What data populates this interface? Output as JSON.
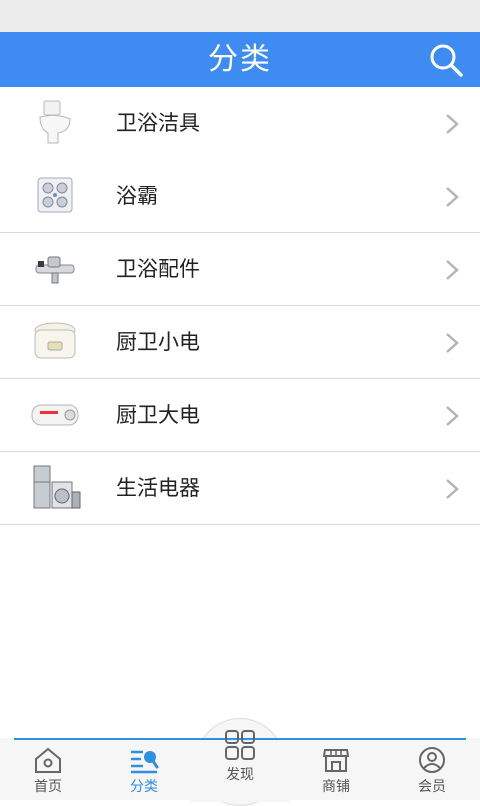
{
  "header": {
    "title": "分类"
  },
  "categories": [
    {
      "label": "卫浴洁具",
      "icon": "toilet-icon"
    },
    {
      "label": "浴霸",
      "icon": "bath-heater-icon"
    },
    {
      "label": "卫浴配件",
      "icon": "faucet-icon"
    },
    {
      "label": "厨卫小电",
      "icon": "rice-cooker-icon"
    },
    {
      "label": "厨卫大电",
      "icon": "water-heater-icon"
    },
    {
      "label": "生活电器",
      "icon": "appliances-icon"
    }
  ],
  "tabbar": {
    "items": [
      {
        "label": "首页",
        "icon": "home-icon"
      },
      {
        "label": "分类",
        "icon": "category-icon",
        "active": true
      },
      {
        "label": "发现",
        "icon": "discover-grid-icon"
      },
      {
        "label": "商铺",
        "icon": "shop-icon"
      },
      {
        "label": "会员",
        "icon": "member-icon"
      }
    ]
  },
  "colors": {
    "accent": "#3e8cf2",
    "tab_active": "#2f8fe0"
  }
}
